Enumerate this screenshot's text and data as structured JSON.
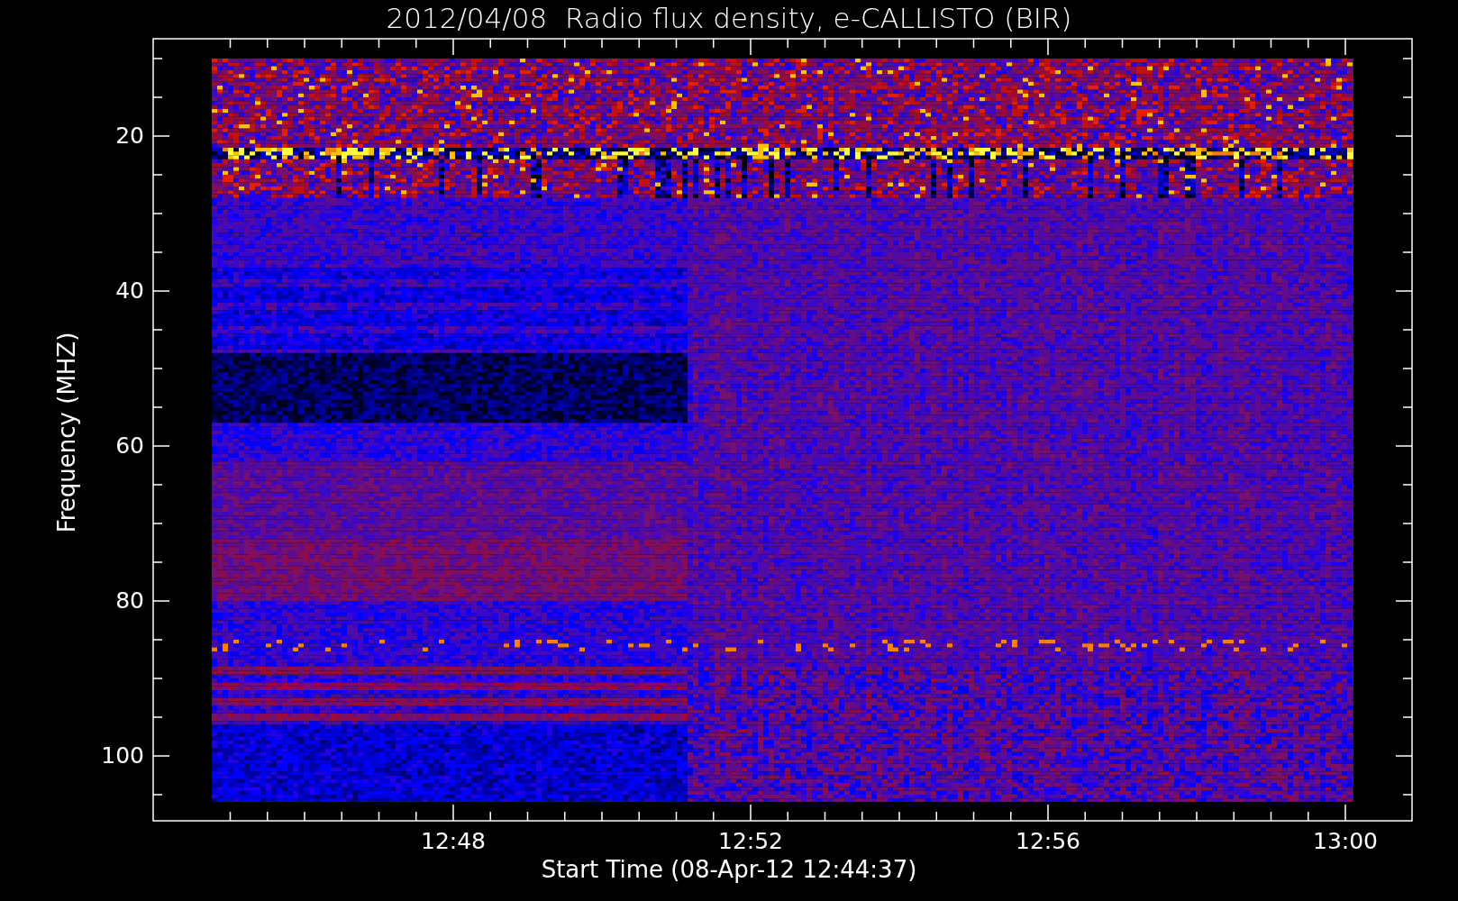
{
  "title": "2012/04/08  Radio flux density, e-CALLISTO (BIR)",
  "y_axis": {
    "label": "Frequency (MHZ)",
    "ticks": [
      "20",
      "40",
      "60",
      "80",
      "100"
    ]
  },
  "x_axis": {
    "label": "Start Time (08-Apr-12 12:44:37)",
    "ticks": [
      "12:48",
      "12:52",
      "12:56",
      "13:00"
    ]
  }
}
